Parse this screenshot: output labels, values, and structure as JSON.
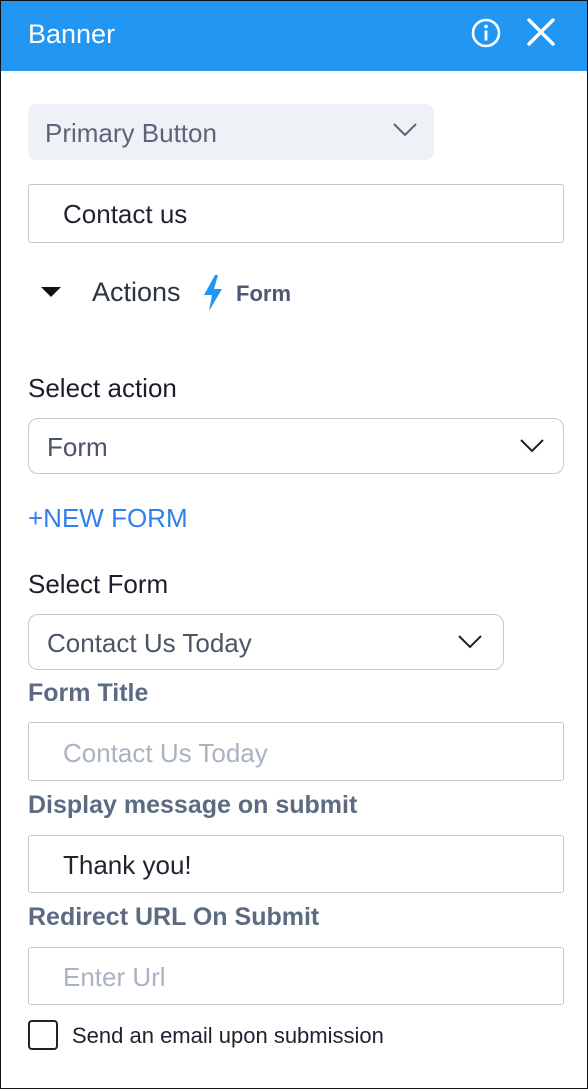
{
  "header": {
    "title": "Banner"
  },
  "button_type": {
    "selected": "Primary Button"
  },
  "button_text": {
    "value": "Contact us"
  },
  "actions": {
    "label": "Actions",
    "current_action": "Form"
  },
  "select_action": {
    "label": "Select action",
    "selected": "Form"
  },
  "new_form": {
    "label": "+NEW FORM"
  },
  "select_form": {
    "label": "Select Form",
    "selected": "Contact Us Today"
  },
  "form_title": {
    "label": "Form Title",
    "placeholder": "Contact Us Today"
  },
  "display_message": {
    "label": "Display message on submit",
    "value": "Thank you!"
  },
  "redirect_url": {
    "label": "Redirect URL On Submit",
    "placeholder": "Enter Url"
  },
  "email_option": {
    "label": "Send an email upon submission",
    "checked": false
  },
  "colors": {
    "header": "#2196f3",
    "link": "#2f80ed",
    "bolt": "#2196f3"
  },
  "icons": [
    "info-icon",
    "close-icon",
    "chevron-down-icon",
    "caret-down-icon",
    "lightning-bolt-icon"
  ]
}
